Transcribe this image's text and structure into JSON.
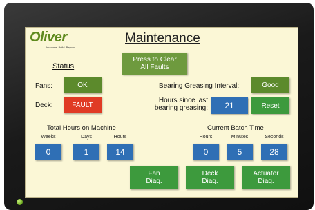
{
  "brand": {
    "logo": "Oliver",
    "tagline": "Innovate. Build. Beyond.",
    "color": "#5f8a1e"
  },
  "title": "Maintenance",
  "clear_faults": "Press to Clear\nAll Faults",
  "status": {
    "heading": "Status",
    "fans_label": "Fans:",
    "fans_value": "OK",
    "deck_label": "Deck:",
    "deck_value": "FAULT"
  },
  "greasing": {
    "interval_label": "Bearing Greasing Interval:",
    "interval_value": "Good",
    "hours_label": "Hours since last\nbearing greasing:",
    "hours_value": "21",
    "reset_label": "Reset"
  },
  "total_hours": {
    "heading": "Total Hours on Machine",
    "columns": [
      {
        "label": "Weeks",
        "value": "0"
      },
      {
        "label": "Days",
        "value": "1"
      },
      {
        "label": "Hours",
        "value": "14"
      }
    ]
  },
  "batch_time": {
    "heading": "Current Batch Time",
    "columns": [
      {
        "label": "Hours",
        "value": "0"
      },
      {
        "label": "Minutes",
        "value": "5"
      },
      {
        "label": "Seconds",
        "value": "28"
      }
    ]
  },
  "diagnostics": {
    "fan": "Fan\nDiag.",
    "deck": "Deck\nDiag.",
    "actuator": "Actuator\nDiag."
  },
  "colors": {
    "ok": "#5c8a2c",
    "fault": "#e03b24",
    "value": "#2f6fb5",
    "action": "#3d9a3d",
    "panel": "#fbf7d6"
  }
}
